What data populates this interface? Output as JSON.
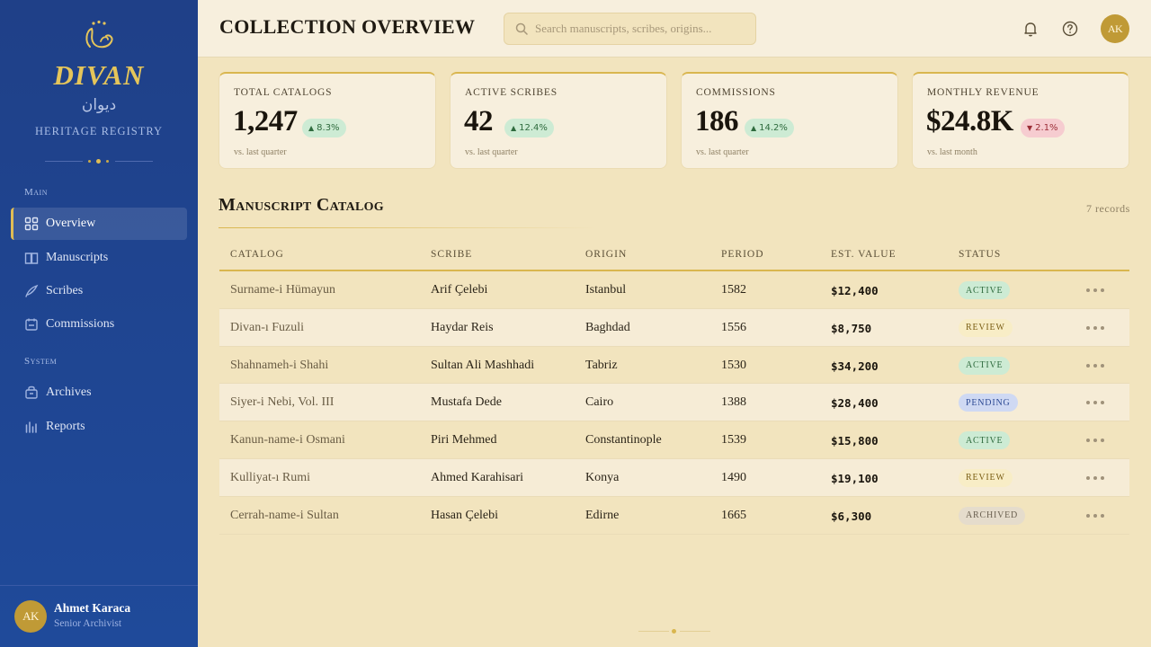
{
  "app": {
    "name": "DIVAN",
    "arabic_name": "ديوان",
    "subtitle": "HERITAGE REGISTRY"
  },
  "sidebar": {
    "sections": [
      {
        "label": "Main",
        "items": [
          {
            "label": "Overview",
            "icon": "grid-icon",
            "active": true
          },
          {
            "label": "Manuscripts",
            "icon": "book-icon"
          },
          {
            "label": "Scribes",
            "icon": "quill-icon"
          },
          {
            "label": "Commissions",
            "icon": "calendar-icon"
          }
        ]
      },
      {
        "label": "System",
        "items": [
          {
            "label": "Archives",
            "icon": "archive-box-icon"
          },
          {
            "label": "Reports",
            "icon": "bar-chart-icon"
          }
        ]
      }
    ],
    "user": {
      "initials": "AK",
      "name": "Ahmet Karaca",
      "role": "Senior Archivist"
    }
  },
  "header": {
    "title": "COLLECTION OVERVIEW",
    "search_placeholder": "Search manuscripts, scribes, origins...",
    "avatar_initials": "AK"
  },
  "stats": [
    {
      "label": "TOTAL CATALOGS",
      "value": "1,247",
      "change": "8.3%",
      "direction": "up",
      "note": "vs. last quarter"
    },
    {
      "label": "ACTIVE SCRIBES",
      "value": "42",
      "change": "12.4%",
      "direction": "up",
      "note": "vs. last quarter"
    },
    {
      "label": "COMMISSIONS",
      "value": "186",
      "change": "14.2%",
      "direction": "up",
      "note": "vs. last quarter"
    },
    {
      "label": "MONTHLY REVENUE",
      "value": "$24.8K",
      "change": "2.1%",
      "direction": "down",
      "note": "vs. last month"
    }
  ],
  "catalog": {
    "title": "Manuscript Catalog",
    "records": "7 records",
    "columns": [
      "CATALOG",
      "SCRIBE",
      "ORIGIN",
      "PERIOD",
      "EST. VALUE",
      "STATUS"
    ],
    "rows": [
      {
        "catalog": "Surname-i Hümayun",
        "scribe": "Arif Çelebi",
        "origin": "Istanbul",
        "period": "1582",
        "value": "$12,400",
        "status": "ACTIVE"
      },
      {
        "catalog": "Divan-ı Fuzuli",
        "scribe": "Haydar Reis",
        "origin": "Baghdad",
        "period": "1556",
        "value": "$8,750",
        "status": "REVIEW"
      },
      {
        "catalog": "Shahnameh-i Shahi",
        "scribe": "Sultan Ali Mashhadi",
        "origin": "Tabriz",
        "period": "1530",
        "value": "$34,200",
        "status": "ACTIVE"
      },
      {
        "catalog": "Siyer-i Nebi, Vol. III",
        "scribe": "Mustafa Dede",
        "origin": "Cairo",
        "period": "1388",
        "value": "$28,400",
        "status": "PENDING"
      },
      {
        "catalog": "Kanun-name-i Osmani",
        "scribe": "Piri Mehmed",
        "origin": "Constantinople",
        "period": "1539",
        "value": "$15,800",
        "status": "ACTIVE"
      },
      {
        "catalog": "Kulliyat-ı Rumi",
        "scribe": "Ahmed Karahisari",
        "origin": "Konya",
        "period": "1490",
        "value": "$19,100",
        "status": "REVIEW"
      },
      {
        "catalog": "Cerrah-name-i Sultan",
        "scribe": "Hasan Çelebi",
        "origin": "Edirne",
        "period": "1665",
        "value": "$6,300",
        "status": "ARCHIVED"
      }
    ]
  }
}
